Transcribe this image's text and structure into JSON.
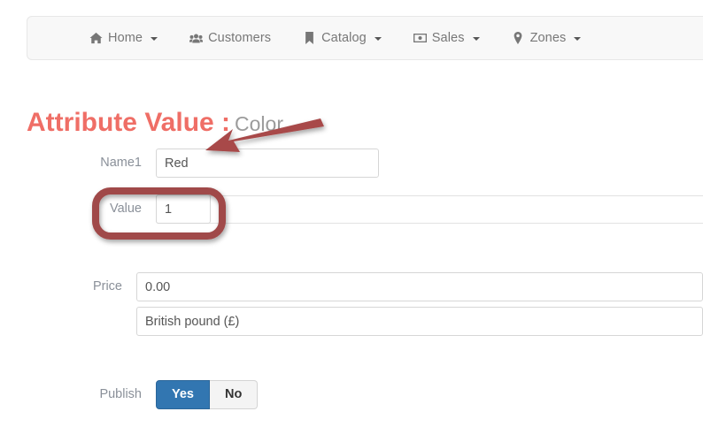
{
  "navbar": {
    "items": [
      {
        "label": "Home",
        "icon": "home-icon",
        "caret": true
      },
      {
        "label": "Customers",
        "icon": "users-icon",
        "caret": false
      },
      {
        "label": "Catalog",
        "icon": "bookmark-icon",
        "caret": true
      },
      {
        "label": "Sales",
        "icon": "money-bill-icon",
        "caret": true
      },
      {
        "label": "Zones",
        "icon": "map-marker-icon",
        "caret": true
      }
    ]
  },
  "page": {
    "title": "Attribute Value :",
    "subject": "Color",
    "title_color": "#ef6e66",
    "subject_color": "#9b9b9b"
  },
  "form": {
    "name": {
      "label": "Name1",
      "value": "Red"
    },
    "value": {
      "label": "Value",
      "value": "1"
    },
    "price": {
      "label": "Price",
      "amount": "0.00",
      "currency": "British pound (£)"
    },
    "publish": {
      "label": "Publish",
      "yes_label": "Yes",
      "no_label": "No",
      "selected": "Yes",
      "active_color": "#3276b1"
    }
  },
  "annotations": {
    "arrow": {
      "name": "red-arrow-annotation",
      "color": "#a84a4a",
      "points_to": "Name1 input"
    },
    "highlight": {
      "name": "red-rounded-rect-annotation",
      "color": "#a04848",
      "surrounds": "Value field"
    }
  }
}
